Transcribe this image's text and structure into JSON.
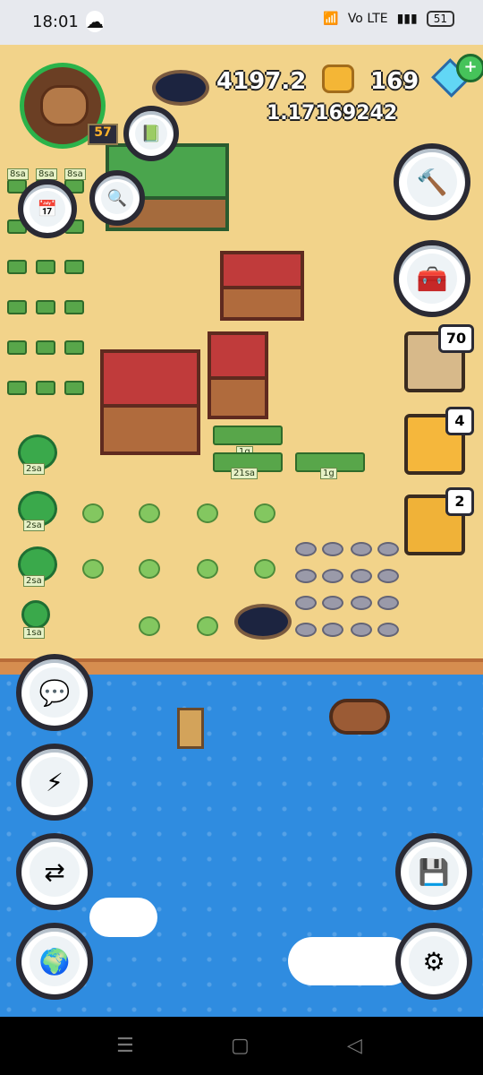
{
  "statusbar": {
    "time": "18:01",
    "cloud_icon": "cloud-icon",
    "wifi_icon": "wifi-icon",
    "signal_label": "Vo LTE",
    "battery": "51"
  },
  "hud": {
    "coins": "4197.2",
    "gems": "169",
    "secondary_currency": "1.17169242",
    "player_level": "57"
  },
  "map_labels": {
    "crop_timer": "8sa",
    "tree_timer": "2sa",
    "small_tree_timer": "1sa",
    "plot1": "1g",
    "plot2": "21sa",
    "plot3": "1g"
  },
  "side_buttons": {
    "count_70": "70",
    "count_4": "4",
    "count_2": "2"
  },
  "nav": {
    "recent": "☰",
    "home": "▢",
    "back": "◁"
  },
  "colors": {
    "sand": "#f2d38a",
    "sea": "#2f8ce0",
    "shore": "#d68d4f",
    "green": "#4aa54d",
    "red_roof": "#c03b3b"
  }
}
